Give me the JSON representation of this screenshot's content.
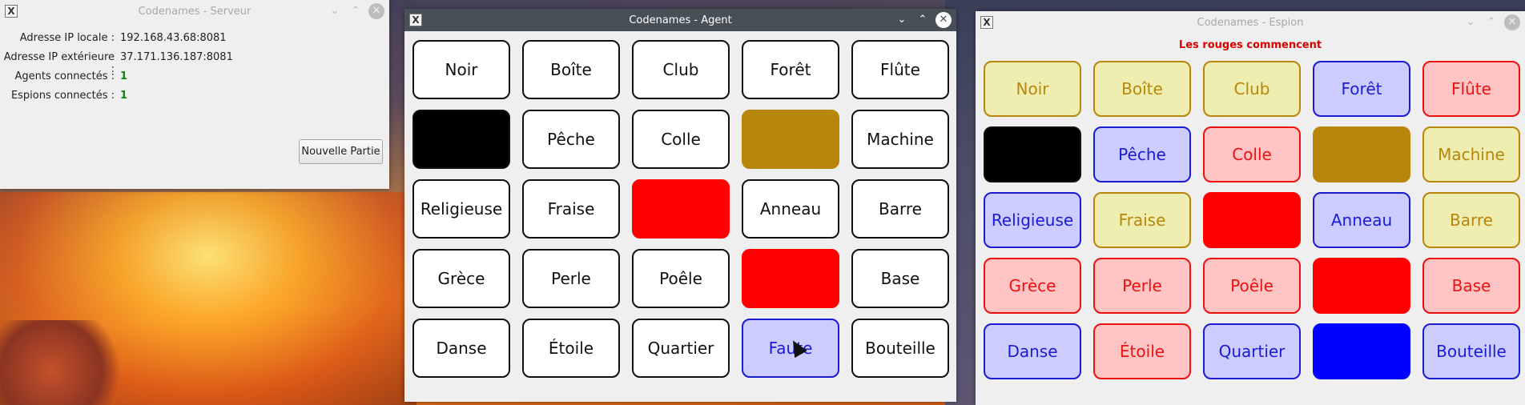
{
  "server": {
    "title": "Codenames - Serveur",
    "rows": [
      {
        "label": "Adresse IP locale :",
        "value": "192.168.43.68:8081"
      },
      {
        "label": "Adresse IP extérieure :",
        "value": "37.171.136.187:8081"
      },
      {
        "label": "Agents connectés :",
        "value": "1"
      },
      {
        "label": "Espions connectés :",
        "value": "1"
      }
    ],
    "new_game_button": "Nouvelle Partie"
  },
  "agent": {
    "title": "Codenames - Agent",
    "cards": [
      {
        "word": "Noir",
        "color": "white"
      },
      {
        "word": "Boîte",
        "color": "white"
      },
      {
        "word": "Club",
        "color": "white"
      },
      {
        "word": "Forêt",
        "color": "white"
      },
      {
        "word": "Flûte",
        "color": "white"
      },
      {
        "word": "",
        "color": "black"
      },
      {
        "word": "Pêche",
        "color": "white"
      },
      {
        "word": "Colle",
        "color": "white"
      },
      {
        "word": "",
        "color": "brown"
      },
      {
        "word": "Machine",
        "color": "white"
      },
      {
        "word": "Religieuse",
        "color": "white"
      },
      {
        "word": "Fraise",
        "color": "white"
      },
      {
        "word": "",
        "color": "red"
      },
      {
        "word": "Anneau",
        "color": "white"
      },
      {
        "word": "Barre",
        "color": "white"
      },
      {
        "word": "Grèce",
        "color": "white"
      },
      {
        "word": "Perle",
        "color": "white"
      },
      {
        "word": "Poêle",
        "color": "white"
      },
      {
        "word": "",
        "color": "red"
      },
      {
        "word": "Base",
        "color": "white"
      },
      {
        "word": "Danse",
        "color": "white"
      },
      {
        "word": "Étoile",
        "color": "white"
      },
      {
        "word": "Quartier",
        "color": "white"
      },
      {
        "word": "Faute",
        "color": "blue"
      },
      {
        "word": "Bouteille",
        "color": "white"
      }
    ]
  },
  "spy": {
    "title": "Codenames - Espion",
    "notice": "Les rouges commencent",
    "cards": [
      {
        "word": "Noir",
        "color": "yellow"
      },
      {
        "word": "Boîte",
        "color": "yellow"
      },
      {
        "word": "Club",
        "color": "yellow"
      },
      {
        "word": "Forêt",
        "color": "blue"
      },
      {
        "word": "Flûte",
        "color": "pink"
      },
      {
        "word": "",
        "color": "black"
      },
      {
        "word": "Pêche",
        "color": "blue"
      },
      {
        "word": "Colle",
        "color": "pink"
      },
      {
        "word": "",
        "color": "brown"
      },
      {
        "word": "Machine",
        "color": "yellow"
      },
      {
        "word": "Religieuse",
        "color": "blue"
      },
      {
        "word": "Fraise",
        "color": "yellow"
      },
      {
        "word": "",
        "color": "red"
      },
      {
        "word": "Anneau",
        "color": "blue"
      },
      {
        "word": "Barre",
        "color": "yellow"
      },
      {
        "word": "Grèce",
        "color": "pink"
      },
      {
        "word": "Perle",
        "color": "pink"
      },
      {
        "word": "Poêle",
        "color": "pink"
      },
      {
        "word": "",
        "color": "red"
      },
      {
        "word": "Base",
        "color": "pink"
      },
      {
        "word": "Danse",
        "color": "blue"
      },
      {
        "word": "Étoile",
        "color": "pink"
      },
      {
        "word": "Quartier",
        "color": "blue"
      },
      {
        "word": "",
        "color": "blue-solid"
      },
      {
        "word": "Bouteille",
        "color": "blue"
      }
    ]
  },
  "icons": {
    "app": "x-app-icon",
    "minimize": "chevron-down-icon",
    "maximize": "chevron-up-icon",
    "close": "close-icon"
  },
  "colors": {
    "active_titlebar": "#475057",
    "card_red": "#ff0000",
    "card_brown": "#b8860b",
    "card_blue_fill": "#ccccff",
    "card_blue_text": "#1b1bd6",
    "card_yellow_fill": "#eeeeb0",
    "card_pink_fill": "#ffc4c4",
    "notice": "#dd0000",
    "connected_count": "#0a8a0a"
  }
}
